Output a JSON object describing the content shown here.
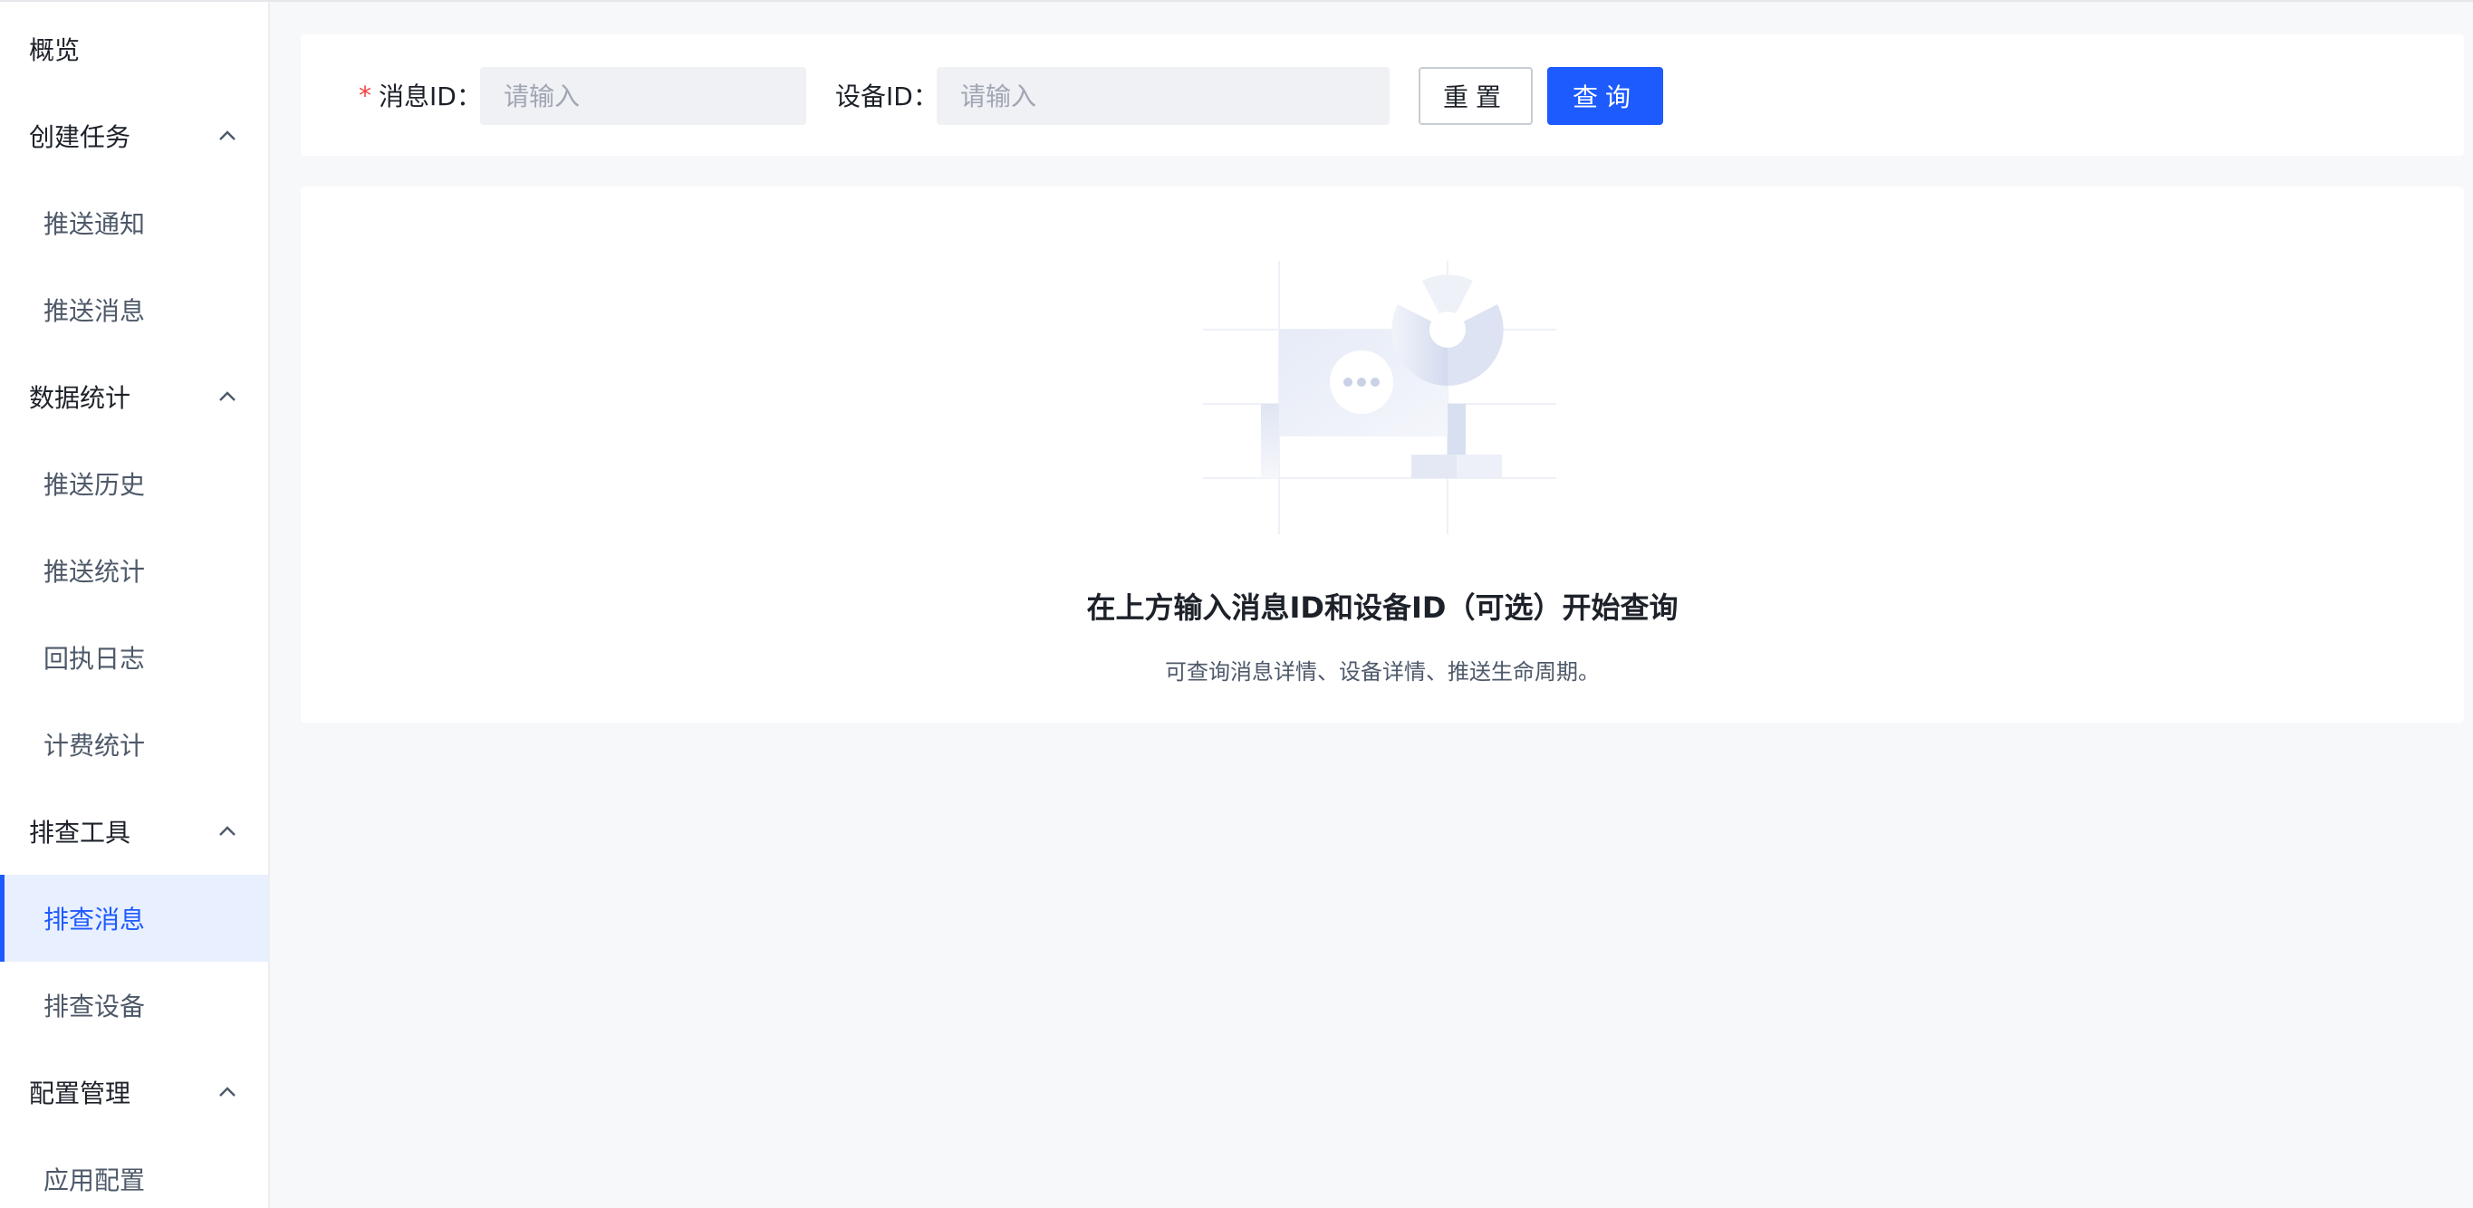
{
  "sidebar": {
    "overview": "概览",
    "groups": [
      {
        "label": "创建任务",
        "items": [
          "推送通知",
          "推送消息"
        ]
      },
      {
        "label": "数据统计",
        "items": [
          "推送历史",
          "推送统计",
          "回执日志",
          "计费统计"
        ]
      },
      {
        "label": "排查工具",
        "items": [
          "排查消息",
          "排查设备"
        ]
      },
      {
        "label": "配置管理",
        "items": [
          "应用配置"
        ]
      }
    ],
    "active_item": "排查消息"
  },
  "search": {
    "message_id_label": "消息ID：",
    "message_id_required": "*",
    "message_id_placeholder": "请输入",
    "device_id_label": "设备ID：",
    "device_id_placeholder": "请输入",
    "reset_label": "重置",
    "query_label": "查询"
  },
  "empty_state": {
    "title": "在上方输入消息ID和设备ID（可选）开始查询",
    "description": "可查询消息详情、设备详情、推送生命周期。"
  },
  "colors": {
    "accent": "#1e5bff",
    "active_bg": "#e8efff",
    "required": "#f53f3f"
  }
}
